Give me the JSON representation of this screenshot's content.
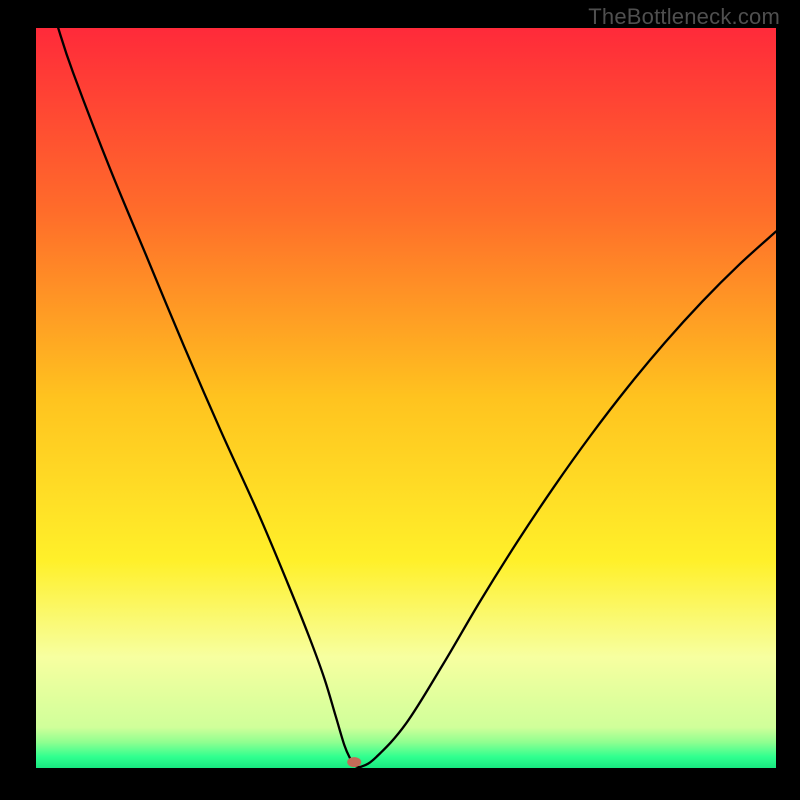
{
  "watermark": "TheBottleneck.com",
  "chart_data": {
    "type": "line",
    "title": "",
    "xlabel": "",
    "ylabel": "",
    "xlim": [
      0,
      100
    ],
    "ylim": [
      0,
      100
    ],
    "grid": false,
    "legend": false,
    "background_gradient": {
      "direction": "top-to-bottom",
      "stops": [
        {
          "pos": 0.0,
          "color": "#ff2a3a"
        },
        {
          "pos": 0.25,
          "color": "#ff6d2a"
        },
        {
          "pos": 0.5,
          "color": "#ffc31f"
        },
        {
          "pos": 0.72,
          "color": "#fff02a"
        },
        {
          "pos": 0.85,
          "color": "#f7ffa0"
        },
        {
          "pos": 0.945,
          "color": "#d0ff9a"
        },
        {
          "pos": 0.965,
          "color": "#90ff90"
        },
        {
          "pos": 0.985,
          "color": "#2fff8f"
        },
        {
          "pos": 1.0,
          "color": "#18e880"
        }
      ]
    },
    "series": [
      {
        "name": "bottleneck-curve",
        "color": "#000000",
        "x": [
          3,
          5,
          10,
          15,
          20,
          25,
          30,
          34,
          37,
          39,
          40.5,
          41.7,
          42.5,
          43,
          44,
          46,
          50,
          55,
          60,
          65,
          70,
          75,
          80,
          85,
          90,
          95,
          100
        ],
        "values": [
          100,
          94,
          81,
          69,
          57,
          45.5,
          34.5,
          25,
          17.5,
          12,
          7,
          3,
          1.2,
          0.4,
          0.2,
          1.5,
          6,
          14,
          22.5,
          30.5,
          38,
          45,
          51.5,
          57.5,
          63,
          68,
          72.5
        ]
      }
    ],
    "marker": {
      "name": "optimal-point",
      "x": 43,
      "y": 0.8,
      "color": "#c46a58",
      "rx": 7,
      "ry": 5
    }
  }
}
